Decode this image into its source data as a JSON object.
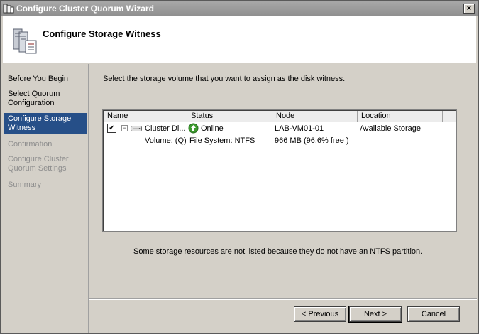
{
  "window": {
    "title": "Configure Cluster Quorum Wizard",
    "close_label": "×"
  },
  "header": {
    "title": "Configure Storage Witness"
  },
  "sidebar": {
    "items": [
      {
        "label": "Before You Begin",
        "state": "normal"
      },
      {
        "label": "Select Quorum Configuration",
        "state": "normal"
      },
      {
        "label": "Configure Storage Witness",
        "state": "active"
      },
      {
        "label": "Confirmation",
        "state": "disabled"
      },
      {
        "label": "Configure Cluster Quorum Settings",
        "state": "disabled"
      },
      {
        "label": "Summary",
        "state": "disabled"
      }
    ]
  },
  "main": {
    "instruction": "Select the storage volume that you want to assign as the disk witness.",
    "columns": [
      "Name",
      "Status",
      "Node",
      "Location"
    ],
    "rows": [
      {
        "checked": true,
        "expander": "−",
        "name": "Cluster Di...",
        "status": "Online",
        "node": "LAB-VM01-01",
        "location": "Available Storage",
        "sub_name": "Volume: (Q)",
        "sub_status": "File System: NTFS",
        "sub_node": "966 MB (96.6% free )"
      }
    ],
    "note": "Some storage resources are not listed because they do not have an NTFS partition."
  },
  "footer": {
    "previous_label": "< Previous",
    "next_label": "Next >",
    "cancel_label": "Cancel"
  },
  "colors": {
    "active_nav": "#264f88",
    "online_green": "#3c9a2e"
  },
  "icons": [
    "wizard-icon",
    "server-stack-icon",
    "disk-icon",
    "online-status-icon",
    "close-icon"
  ]
}
